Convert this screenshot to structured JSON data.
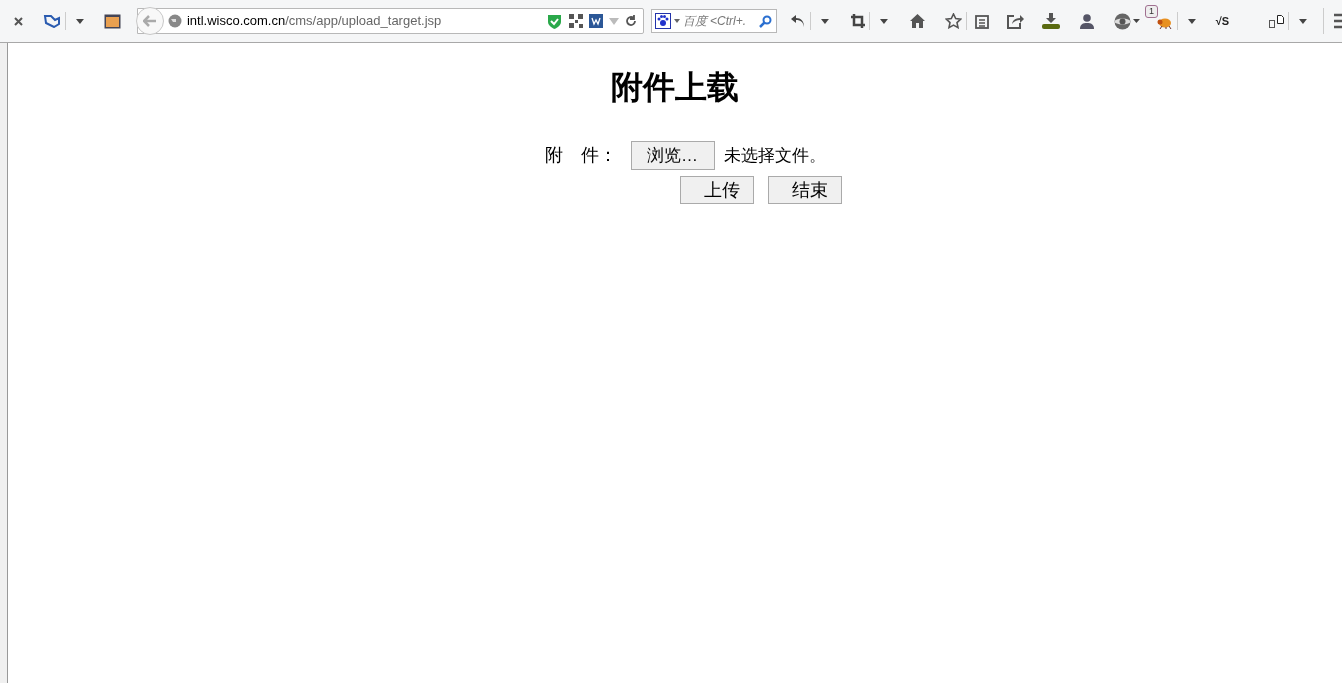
{
  "toolbar": {
    "url_host": "intl.wisco.com.cn",
    "url_path": "/cms/app/upload_target.jsp",
    "search_placeholder": "百度 <Ctrl+.",
    "notification_count": "1",
    "script_label": "√S"
  },
  "page": {
    "title": "附件上载",
    "attachment_label": "附　件：",
    "browse_button": "浏览…",
    "no_file_text": "未选择文件。",
    "buttons": [
      "上传",
      "结束"
    ]
  }
}
